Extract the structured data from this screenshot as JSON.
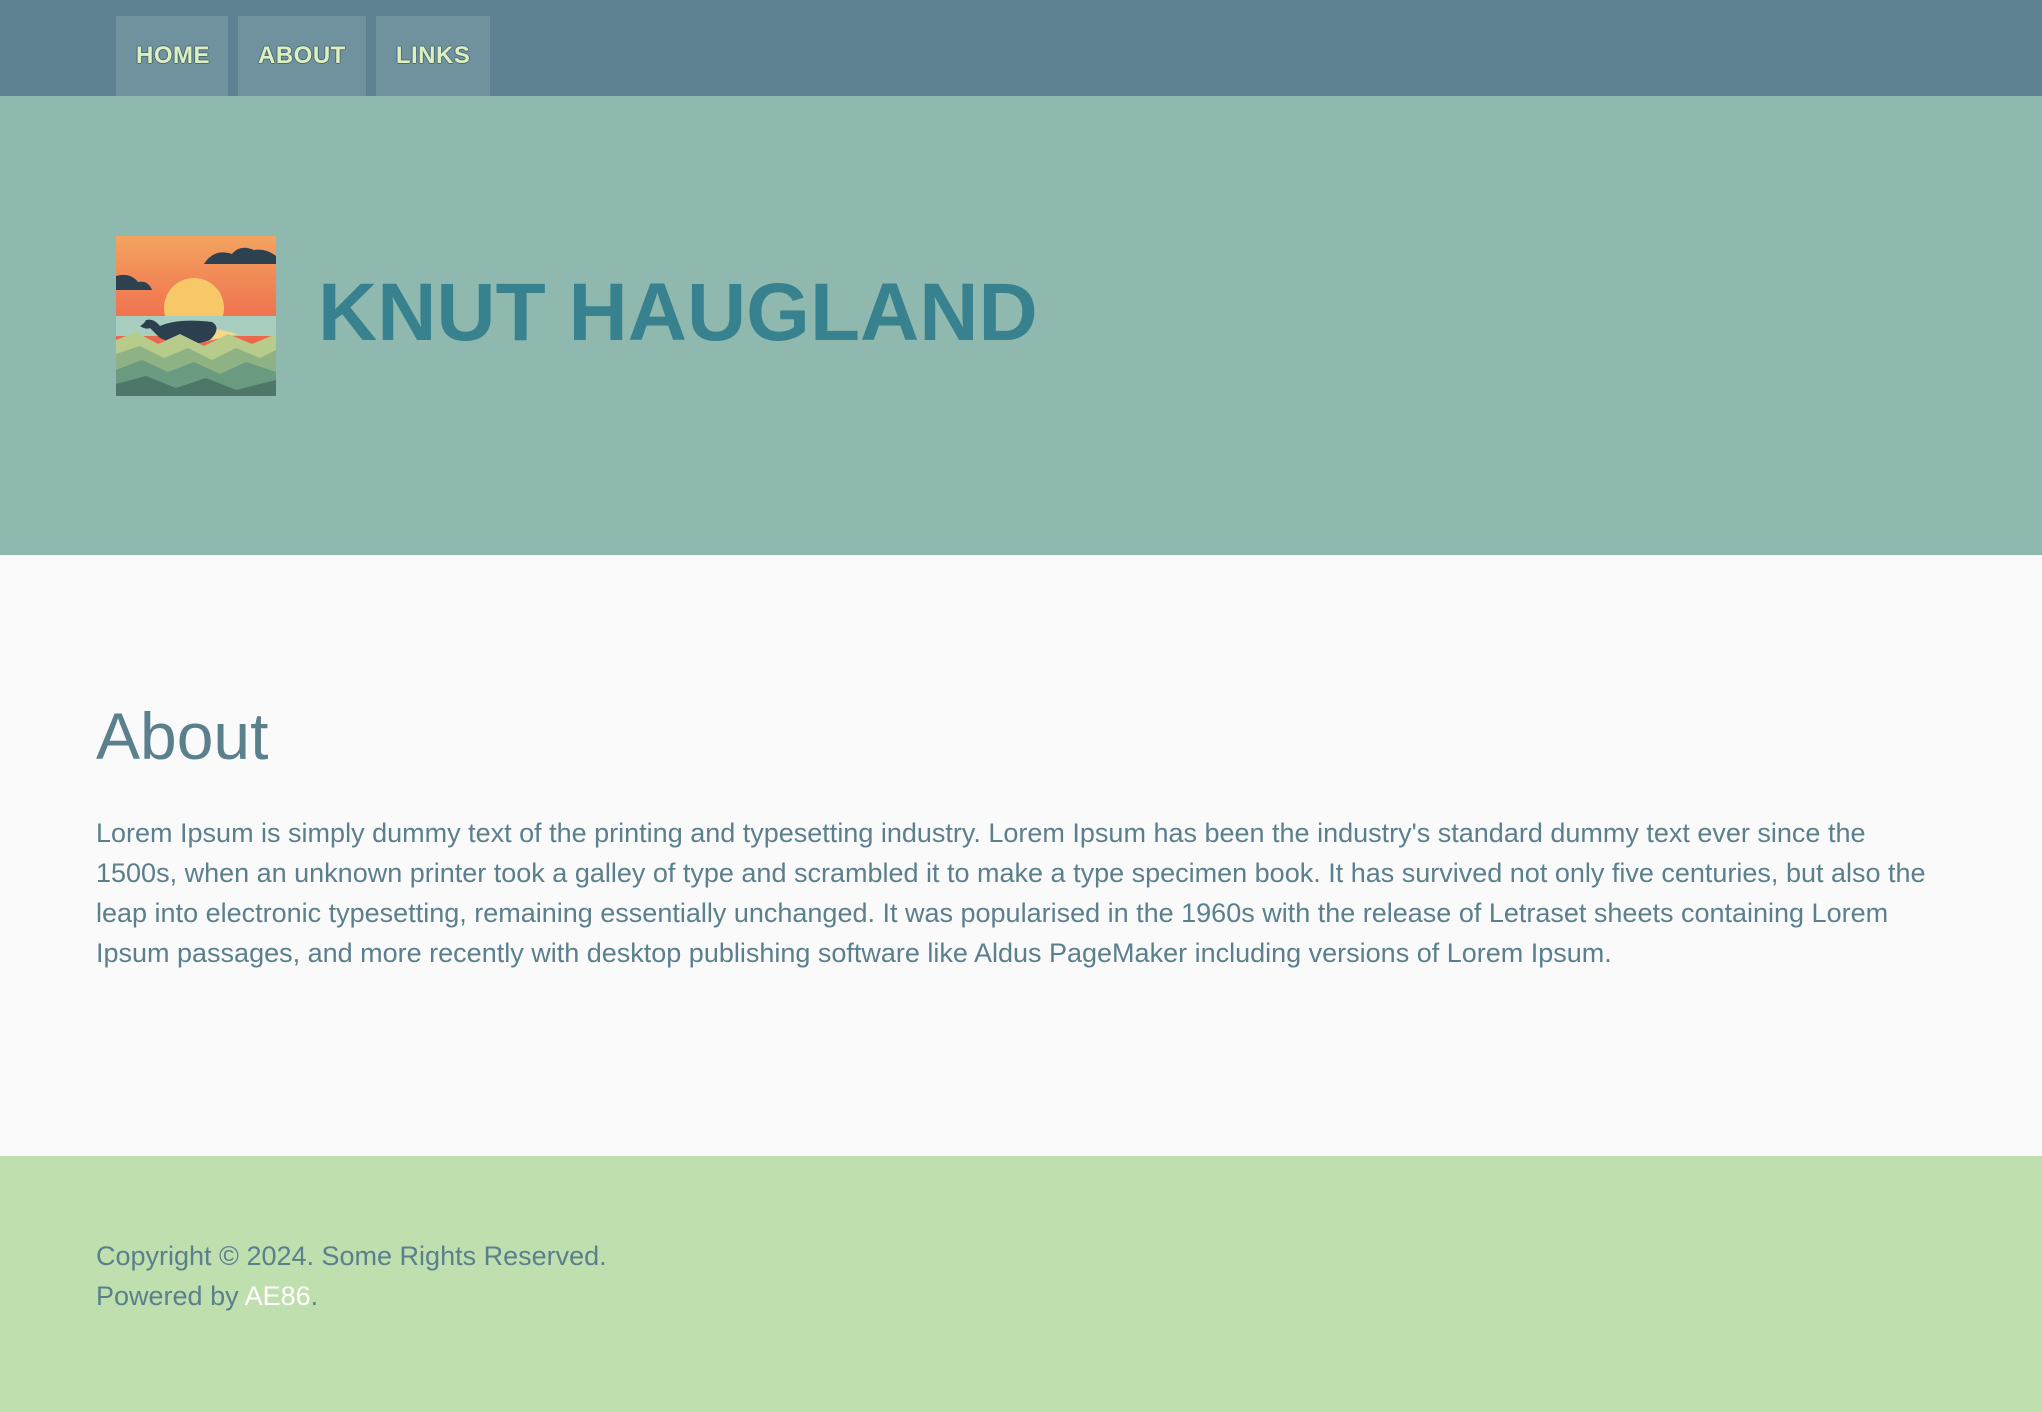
{
  "nav": {
    "items": [
      {
        "label": "HOME"
      },
      {
        "label": "ABOUT"
      },
      {
        "label": "LINKS"
      }
    ]
  },
  "header": {
    "logo": "sunset-whale-logo",
    "title": "KNUT HAUGLAND"
  },
  "main": {
    "heading": "About",
    "body": "Lorem Ipsum is simply dummy text of the printing and typesetting industry. Lorem Ipsum has been the industry's standard dummy text ever since the 1500s, when an unknown printer took a galley of type and scrambled it to make a type specimen book. It has survived not only five centuries, but also the leap into electronic typesetting, remaining essentially unchanged. It was popularised in the 1960s with the release of Letraset sheets containing Lorem Ipsum passages, and more recently with desktop publishing software like Aldus PageMaker including versions of Lorem Ipsum."
  },
  "footer": {
    "copyright": "Copyright © 2024. Some Rights Reserved.",
    "powered_prefix": "Powered by ",
    "powered_link": "AE86",
    "powered_suffix": "."
  },
  "colors": {
    "nav_bg": "#5e8291",
    "nav_item_bg": "#6f929e",
    "nav_text": "#dcefc0",
    "hero_bg": "#8fb8ae",
    "title": "#38818f",
    "content_bg": "#fafafa",
    "text": "#5a7f8d",
    "footer_bg": "#bfe0ae",
    "link": "#ffffff"
  }
}
